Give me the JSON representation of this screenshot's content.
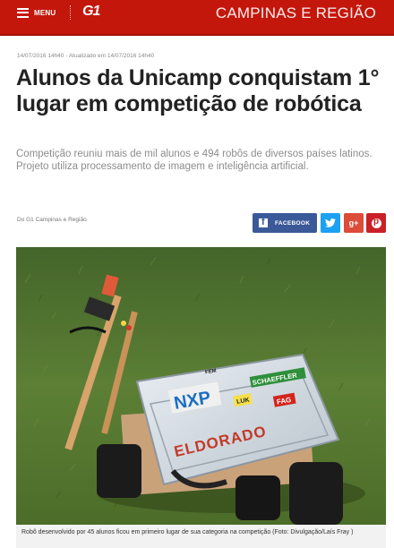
{
  "header": {
    "menu_label": "MENU",
    "logo_text": "G1",
    "section": "CAMPINAS E REGIÃO",
    "brand_color": "#c4170c"
  },
  "article": {
    "dateline": "14/07/2016 14h40 - Atualizado em 14/07/2016 14h40",
    "title": "Alunos da Unicamp conquistam 1° lugar em competição de robótica",
    "subtitle_1": "Competição reuniu mais de mil alunos e 494 robôs de diversos países latinos.",
    "subtitle_2": "Projeto utiliza processamento de imagem e inteligência artificial.",
    "byline": "Do G1 Campinas e Região"
  },
  "share": {
    "facebook_label": "FACEBOOK",
    "facebook_color": "#3b5998",
    "twitter_icon": "twitter-bird-icon",
    "gplus_icon": "g-plus-icon",
    "gplus_text": "g+",
    "pinterest_icon": "pinterest-icon"
  },
  "photo": {
    "box_label_1": "NXP",
    "box_label_2": "SCHAEFFLER",
    "box_label_3": "FAG",
    "box_label_4": "LUK",
    "box_label_5": "ELDORADO",
    "box_label_6": "FEM",
    "caption": "Robô desenvolvido por 45 alunos ficou em primeiro lugar de sua categoria na competição (Foto: Divulgação/Laís Fray )"
  }
}
